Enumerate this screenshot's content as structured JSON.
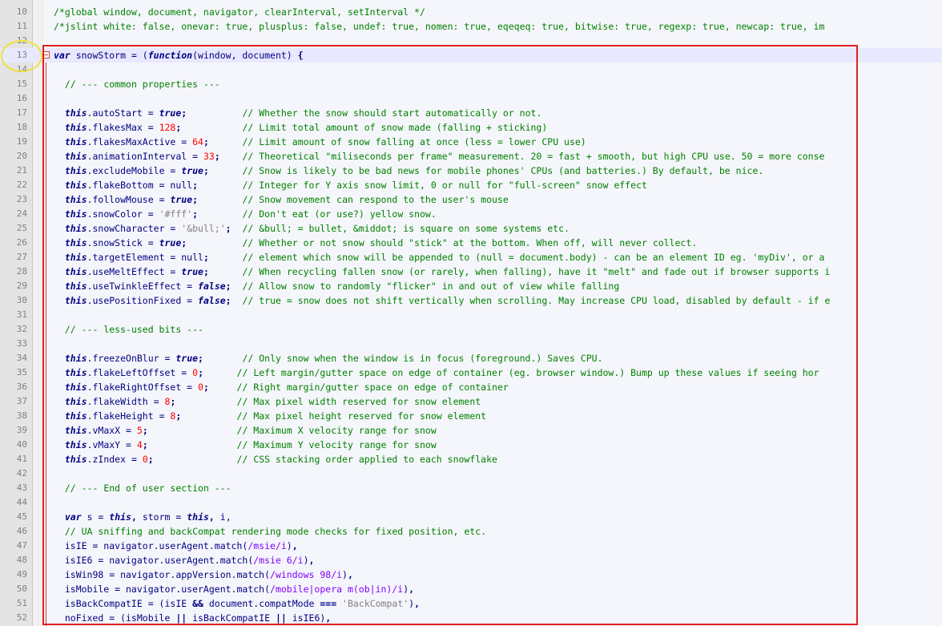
{
  "editor": {
    "lines": [
      {
        "n": "10",
        "tokens": [
          [
            "cm",
            "/*global window, document, navigator, clearInterval, setInterval */"
          ]
        ]
      },
      {
        "n": "11",
        "tokens": [
          [
            "cm",
            "/*jslint white: false, onevar: true, plusplus: false, undef: true, nomen: true, eqeqeq: true, bitwise: true, regexp: true, newcap: true, im"
          ]
        ]
      },
      {
        "n": "12",
        "tokens": []
      },
      {
        "n": "13",
        "current": true,
        "fold": true,
        "tokens": [
          [
            "kwi",
            "var"
          ],
          [
            "id",
            " snowStorm = ("
          ],
          [
            "kwi",
            "function"
          ],
          [
            "id",
            "(window, document) "
          ],
          [
            "op",
            "{"
          ]
        ]
      },
      {
        "n": "14",
        "tokens": []
      },
      {
        "n": "15",
        "tokens": [
          [
            "id",
            "  "
          ],
          [
            "cm",
            "// --- common properties ---"
          ]
        ]
      },
      {
        "n": "16",
        "tokens": []
      },
      {
        "n": "17",
        "tokens": [
          [
            "id",
            "  "
          ],
          [
            "kwi",
            "this"
          ],
          [
            "id",
            ".autoStart = "
          ],
          [
            "kwi",
            "true"
          ],
          [
            "op",
            ";"
          ],
          [
            "id",
            "          "
          ],
          [
            "cm",
            "// Whether the snow should start automatically or not."
          ]
        ]
      },
      {
        "n": "18",
        "tokens": [
          [
            "id",
            "  "
          ],
          [
            "kwi",
            "this"
          ],
          [
            "id",
            ".flakesMax = "
          ],
          [
            "num",
            "128"
          ],
          [
            "op",
            ";"
          ],
          [
            "id",
            "           "
          ],
          [
            "cm",
            "// Limit total amount of snow made (falling + sticking)"
          ]
        ]
      },
      {
        "n": "19",
        "tokens": [
          [
            "id",
            "  "
          ],
          [
            "kwi",
            "this"
          ],
          [
            "id",
            ".flakesMaxActive = "
          ],
          [
            "num",
            "64"
          ],
          [
            "op",
            ";"
          ],
          [
            "id",
            "      "
          ],
          [
            "cm",
            "// Limit amount of snow falling at once (less = lower CPU use)"
          ]
        ]
      },
      {
        "n": "20",
        "tokens": [
          [
            "id",
            "  "
          ],
          [
            "kwi",
            "this"
          ],
          [
            "id",
            ".animationInterval = "
          ],
          [
            "num",
            "33"
          ],
          [
            "op",
            ";"
          ],
          [
            "id",
            "    "
          ],
          [
            "cm",
            "// Theoretical \"miliseconds per frame\" measurement. 20 = fast + smooth, but high CPU use. 50 = more conse"
          ]
        ]
      },
      {
        "n": "21",
        "tokens": [
          [
            "id",
            "  "
          ],
          [
            "kwi",
            "this"
          ],
          [
            "id",
            ".excludeMobile = "
          ],
          [
            "kwi",
            "true"
          ],
          [
            "op",
            ";"
          ],
          [
            "id",
            "      "
          ],
          [
            "cm",
            "// Snow is likely to be bad news for mobile phones' CPUs (and batteries.) By default, be nice."
          ]
        ]
      },
      {
        "n": "22",
        "tokens": [
          [
            "id",
            "  "
          ],
          [
            "kwi",
            "this"
          ],
          [
            "id",
            ".flakeBottom = null"
          ],
          [
            "op",
            ";"
          ],
          [
            "id",
            "        "
          ],
          [
            "cm",
            "// Integer for Y axis snow limit, 0 or null for \"full-screen\" snow effect"
          ]
        ]
      },
      {
        "n": "23",
        "tokens": [
          [
            "id",
            "  "
          ],
          [
            "kwi",
            "this"
          ],
          [
            "id",
            ".followMouse = "
          ],
          [
            "kwi",
            "true"
          ],
          [
            "op",
            ";"
          ],
          [
            "id",
            "        "
          ],
          [
            "cm",
            "// Snow movement can respond to the user's mouse"
          ]
        ]
      },
      {
        "n": "24",
        "tokens": [
          [
            "id",
            "  "
          ],
          [
            "kwi",
            "this"
          ],
          [
            "id",
            ".snowColor = "
          ],
          [
            "str",
            "'#fff'"
          ],
          [
            "op",
            ";"
          ],
          [
            "id",
            "        "
          ],
          [
            "cm",
            "// Don't eat (or use?) yellow snow."
          ]
        ]
      },
      {
        "n": "25",
        "tokens": [
          [
            "id",
            "  "
          ],
          [
            "kwi",
            "this"
          ],
          [
            "id",
            ".snowCharacter = "
          ],
          [
            "str",
            "'&bull;'"
          ],
          [
            "op",
            ";"
          ],
          [
            "id",
            "  "
          ],
          [
            "cm",
            "// &bull; = bullet, &middot; is square on some systems etc."
          ]
        ]
      },
      {
        "n": "26",
        "tokens": [
          [
            "id",
            "  "
          ],
          [
            "kwi",
            "this"
          ],
          [
            "id",
            ".snowStick = "
          ],
          [
            "kwi",
            "true"
          ],
          [
            "op",
            ";"
          ],
          [
            "id",
            "          "
          ],
          [
            "cm",
            "// Whether or not snow should \"stick\" at the bottom. When off, will never collect."
          ]
        ]
      },
      {
        "n": "27",
        "tokens": [
          [
            "id",
            "  "
          ],
          [
            "kwi",
            "this"
          ],
          [
            "id",
            ".targetElement = null"
          ],
          [
            "op",
            ";"
          ],
          [
            "id",
            "      "
          ],
          [
            "cm",
            "// element which snow will be appended to (null = document.body) - can be an element ID eg. 'myDiv', or a"
          ]
        ]
      },
      {
        "n": "28",
        "tokens": [
          [
            "id",
            "  "
          ],
          [
            "kwi",
            "this"
          ],
          [
            "id",
            ".useMeltEffect = "
          ],
          [
            "kwi",
            "true"
          ],
          [
            "op",
            ";"
          ],
          [
            "id",
            "      "
          ],
          [
            "cm",
            "// When recycling fallen snow (or rarely, when falling), have it \"melt\" and fade out if browser supports i"
          ]
        ]
      },
      {
        "n": "29",
        "tokens": [
          [
            "id",
            "  "
          ],
          [
            "kwi",
            "this"
          ],
          [
            "id",
            ".useTwinkleEffect = "
          ],
          [
            "kwi",
            "false"
          ],
          [
            "op",
            ";"
          ],
          [
            "id",
            "  "
          ],
          [
            "cm",
            "// Allow snow to randomly \"flicker\" in and out of view while falling"
          ]
        ]
      },
      {
        "n": "30",
        "tokens": [
          [
            "id",
            "  "
          ],
          [
            "kwi",
            "this"
          ],
          [
            "id",
            ".usePositionFixed = "
          ],
          [
            "kwi",
            "false"
          ],
          [
            "op",
            ";"
          ],
          [
            "id",
            "  "
          ],
          [
            "cm",
            "// true = snow does not shift vertically when scrolling. May increase CPU load, disabled by default - if e"
          ]
        ]
      },
      {
        "n": "31",
        "tokens": []
      },
      {
        "n": "32",
        "tokens": [
          [
            "id",
            "  "
          ],
          [
            "cm",
            "// --- less-used bits ---"
          ]
        ]
      },
      {
        "n": "33",
        "tokens": []
      },
      {
        "n": "34",
        "tokens": [
          [
            "id",
            "  "
          ],
          [
            "kwi",
            "this"
          ],
          [
            "id",
            ".freezeOnBlur = "
          ],
          [
            "kwi",
            "true"
          ],
          [
            "op",
            ";"
          ],
          [
            "id",
            "       "
          ],
          [
            "cm",
            "// Only snow when the window is in focus (foreground.) Saves CPU."
          ]
        ]
      },
      {
        "n": "35",
        "tokens": [
          [
            "id",
            "  "
          ],
          [
            "kwi",
            "this"
          ],
          [
            "id",
            ".flakeLeftOffset = "
          ],
          [
            "num",
            "0"
          ],
          [
            "op",
            ";"
          ],
          [
            "id",
            "      "
          ],
          [
            "cm",
            "// Left margin/gutter space on edge of container (eg. browser window.) Bump up these values if seeing hor"
          ]
        ]
      },
      {
        "n": "36",
        "tokens": [
          [
            "id",
            "  "
          ],
          [
            "kwi",
            "this"
          ],
          [
            "id",
            ".flakeRightOffset = "
          ],
          [
            "num",
            "0"
          ],
          [
            "op",
            ";"
          ],
          [
            "id",
            "     "
          ],
          [
            "cm",
            "// Right margin/gutter space on edge of container"
          ]
        ]
      },
      {
        "n": "37",
        "tokens": [
          [
            "id",
            "  "
          ],
          [
            "kwi",
            "this"
          ],
          [
            "id",
            ".flakeWidth = "
          ],
          [
            "num",
            "8"
          ],
          [
            "op",
            ";"
          ],
          [
            "id",
            "           "
          ],
          [
            "cm",
            "// Max pixel width reserved for snow element"
          ]
        ]
      },
      {
        "n": "38",
        "tokens": [
          [
            "id",
            "  "
          ],
          [
            "kwi",
            "this"
          ],
          [
            "id",
            ".flakeHeight = "
          ],
          [
            "num",
            "8"
          ],
          [
            "op",
            ";"
          ],
          [
            "id",
            "          "
          ],
          [
            "cm",
            "// Max pixel height reserved for snow element"
          ]
        ]
      },
      {
        "n": "39",
        "tokens": [
          [
            "id",
            "  "
          ],
          [
            "kwi",
            "this"
          ],
          [
            "id",
            ".vMaxX = "
          ],
          [
            "num",
            "5"
          ],
          [
            "op",
            ";"
          ],
          [
            "id",
            "                "
          ],
          [
            "cm",
            "// Maximum X velocity range for snow"
          ]
        ]
      },
      {
        "n": "40",
        "tokens": [
          [
            "id",
            "  "
          ],
          [
            "kwi",
            "this"
          ],
          [
            "id",
            ".vMaxY = "
          ],
          [
            "num",
            "4"
          ],
          [
            "op",
            ";"
          ],
          [
            "id",
            "                "
          ],
          [
            "cm",
            "// Maximum Y velocity range for snow"
          ]
        ]
      },
      {
        "n": "41",
        "tokens": [
          [
            "id",
            "  "
          ],
          [
            "kwi",
            "this"
          ],
          [
            "id",
            ".zIndex = "
          ],
          [
            "num",
            "0"
          ],
          [
            "op",
            ";"
          ],
          [
            "id",
            "               "
          ],
          [
            "cm",
            "// CSS stacking order applied to each snowflake"
          ]
        ]
      },
      {
        "n": "42",
        "tokens": []
      },
      {
        "n": "43",
        "tokens": [
          [
            "id",
            "  "
          ],
          [
            "cm",
            "// --- End of user section ---"
          ]
        ]
      },
      {
        "n": "44",
        "tokens": []
      },
      {
        "n": "45",
        "tokens": [
          [
            "id",
            "  "
          ],
          [
            "kwi",
            "var"
          ],
          [
            "id",
            " s = "
          ],
          [
            "kwi",
            "this"
          ],
          [
            "op",
            ","
          ],
          [
            "id",
            " storm = "
          ],
          [
            "kwi",
            "this"
          ],
          [
            "op",
            ","
          ],
          [
            "id",
            " i,"
          ]
        ]
      },
      {
        "n": "46",
        "tokens": [
          [
            "id",
            "  "
          ],
          [
            "cm",
            "// UA sniffing and backCompat rendering mode checks for fixed position, etc."
          ]
        ]
      },
      {
        "n": "47",
        "tokens": [
          [
            "id",
            "  isIE = navigator.userAgent.match("
          ],
          [
            "re",
            "/msie/i"
          ],
          [
            "id",
            ")"
          ],
          [
            "op",
            ","
          ]
        ]
      },
      {
        "n": "48",
        "tokens": [
          [
            "id",
            "  isIE6 = navigator.userAgent.match("
          ],
          [
            "re",
            "/msie 6/i"
          ],
          [
            "id",
            ")"
          ],
          [
            "op",
            ","
          ]
        ]
      },
      {
        "n": "49",
        "tokens": [
          [
            "id",
            "  isWin98 = navigator.appVersion.match("
          ],
          [
            "re",
            "/windows 98/i"
          ],
          [
            "id",
            ")"
          ],
          [
            "op",
            ","
          ]
        ]
      },
      {
        "n": "50",
        "tokens": [
          [
            "id",
            "  isMobile = navigator.userAgent.match("
          ],
          [
            "re",
            "/mobile|opera m(ob|in)/i"
          ],
          [
            "id",
            ")"
          ],
          [
            "op",
            ","
          ]
        ]
      },
      {
        "n": "51",
        "tokens": [
          [
            "id",
            "  isBackCompatIE = (isIE "
          ],
          [
            "op",
            "&&"
          ],
          [
            "id",
            " document.compatMode "
          ],
          [
            "op",
            "==="
          ],
          [
            "id",
            " "
          ],
          [
            "str",
            "'BackCompat'"
          ],
          [
            "id",
            ")"
          ],
          [
            "op",
            ","
          ]
        ]
      },
      {
        "n": "52",
        "tokens": [
          [
            "id",
            "  noFixed = (isMobile "
          ],
          [
            "op",
            "||"
          ],
          [
            "id",
            " isBackCompatIE "
          ],
          [
            "op",
            "||"
          ],
          [
            "id",
            " isIE6)"
          ],
          [
            "op",
            ","
          ]
        ]
      }
    ]
  },
  "colors": {
    "highlight_box": "#e02020",
    "circle_marker": "#f0e040",
    "fold_marker": "#d04040"
  }
}
